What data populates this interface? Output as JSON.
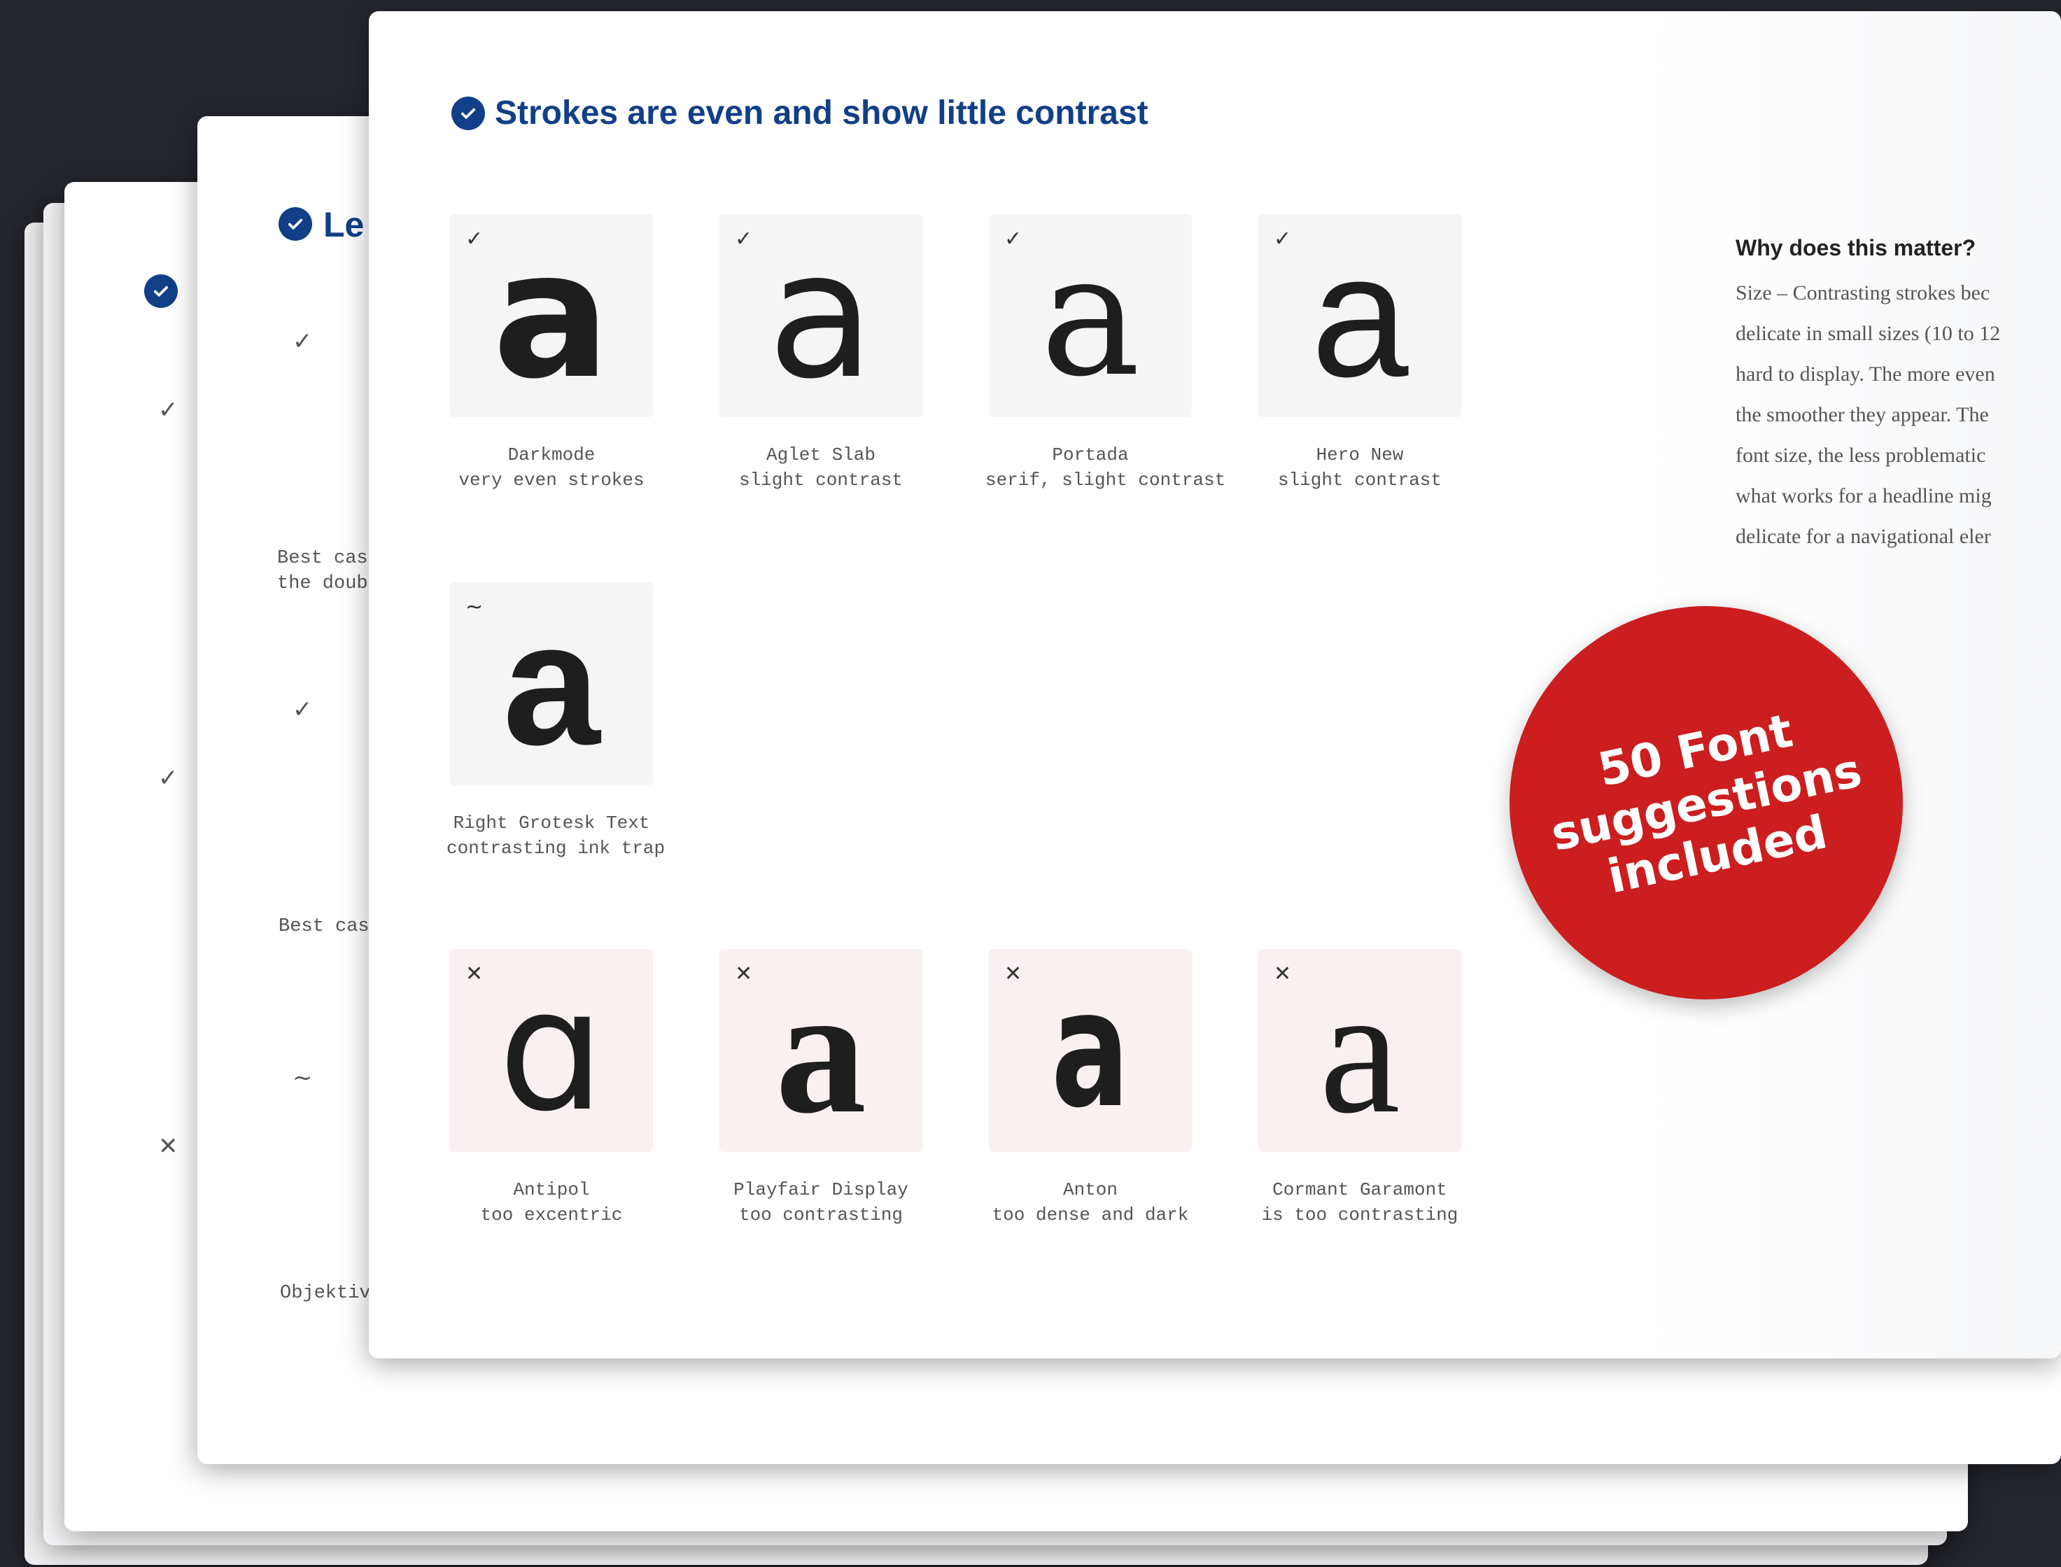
{
  "colors": {
    "background": "#24262d",
    "accent_blue": "#113f88",
    "badge_red": "#cc1d1f"
  },
  "back_card_3": {
    "marks": [
      "✓",
      "✓",
      "✕"
    ]
  },
  "middle_card": {
    "title_fragment": "Le",
    "marks": [
      "✓",
      "✓",
      "~"
    ],
    "texts": [
      "Best case\nthe doubl",
      "Best case",
      "Objektiv"
    ]
  },
  "front_card": {
    "title": "Strokes are even and show little contrast",
    "good_fonts": [
      {
        "mark": "✓",
        "glyph": "a",
        "name": "Darkmode",
        "note": "very even strokes"
      },
      {
        "mark": "✓",
        "glyph": "a",
        "name": "Aglet Slab",
        "note": "slight contrast"
      },
      {
        "mark": "✓",
        "glyph": "a",
        "name": "Portada",
        "note": "serif, slight contrast"
      },
      {
        "mark": "✓",
        "glyph": "a",
        "name": "Hero New",
        "note": "slight contrast"
      }
    ],
    "neutral_fonts": [
      {
        "mark": "~",
        "glyph": "a",
        "name": "Right Grotesk Text",
        "note": "contrasting ink trap"
      }
    ],
    "bad_fonts": [
      {
        "mark": "✕",
        "glyph": "ɑ",
        "name": "Antipol",
        "note": "too excentric"
      },
      {
        "mark": "✕",
        "glyph": "a",
        "name": "Playfair Display",
        "note": "too contrasting"
      },
      {
        "mark": "✕",
        "glyph": "a",
        "name": "Anton",
        "note": "too dense and dark"
      },
      {
        "mark": "✕",
        "glyph": "a",
        "name": "Cormant Garamont",
        "note": "is too contrasting"
      }
    ],
    "why_heading": "Why does this matter?",
    "why_body": "Size – Contrasting strokes bec\ndelicate in small sizes (10 to 12\nhard to display. The more even\nthe smoother they appear. The\nfont size, the less problematic\nwhat works for a headline mig\ndelicate for a navigational eler"
  },
  "badge": {
    "lines": [
      "50 Font",
      "suggestions",
      "included"
    ]
  }
}
